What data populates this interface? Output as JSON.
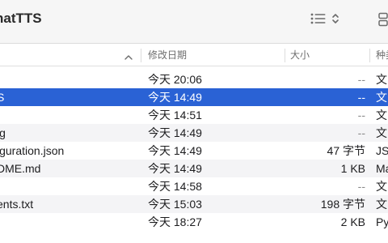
{
  "window": {
    "title": "hatTTS"
  },
  "columns": {
    "date": "修改日期",
    "size": "大小",
    "kind": "种类"
  },
  "files": [
    {
      "name": "",
      "date": "今天 20:06",
      "size": "--",
      "kind": "文",
      "selected": false
    },
    {
      "name": "S",
      "date": "今天 14:49",
      "size": "--",
      "kind": "文",
      "selected": true
    },
    {
      "name": "t",
      "date": "今天 14:51",
      "size": "--",
      "kind": "文",
      "selected": false
    },
    {
      "name": "ig",
      "date": "今天 14:49",
      "size": "--",
      "kind": "文",
      "selected": false
    },
    {
      "name": "iguration.json",
      "date": "今天 14:49",
      "size": "47 字节",
      "kind": "JS",
      "selected": false
    },
    {
      "name": "DME.md",
      "date": "今天 14:49",
      "size": "1 KB",
      "kind": "Ma",
      "selected": false
    },
    {
      "name": "",
      "date": "今天 14:58",
      "size": "--",
      "kind": "文",
      "selected": false
    },
    {
      "name": "ents.txt",
      "date": "今天 15:03",
      "size": "198 字节",
      "kind": "文",
      "selected": false
    },
    {
      "name": "",
      "date": "今天 18:27",
      "size": "2 KB",
      "kind": "Py",
      "selected": false
    }
  ],
  "icons": {
    "view": "list-view-icon",
    "view_toggle": "chevron-updown-icon",
    "group": "group-icon",
    "sort": "chevron-up-icon"
  }
}
